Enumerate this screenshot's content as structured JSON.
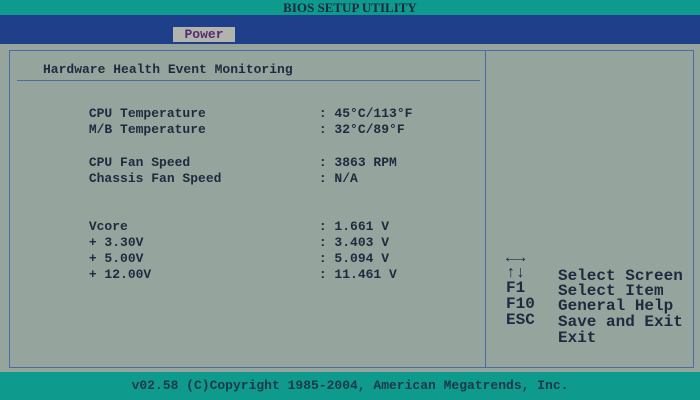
{
  "title": "BIOS SETUP UTILITY",
  "menu": {
    "active_tab": "Power"
  },
  "section": {
    "title": "Hardware Health Event Monitoring"
  },
  "readings": [
    {
      "label": "CPU Temperature",
      "value": ": 45°C/113°F"
    },
    {
      "label": "M/B Temperature",
      "value": ": 32°C/89°F"
    },
    {
      "label": "CPU Fan Speed",
      "value": ": 3863 RPM"
    },
    {
      "label": "Chassis Fan Speed",
      "value": ": N/A"
    },
    {
      "label": "Vcore",
      "value": ": 1.661 V"
    },
    {
      "label": "+ 3.30V",
      "value": ": 3.403 V"
    },
    {
      "label": "+ 5.00V",
      "value": ": 5.094 V"
    },
    {
      "label": "+ 12.00V",
      "value": ": 11.461 V"
    }
  ],
  "help": [
    {
      "key": "←→",
      "desc": "Select Screen"
    },
    {
      "key": "↑↓",
      "desc": "Select Item"
    },
    {
      "key": "F1",
      "desc": "General Help"
    },
    {
      "key": "F10",
      "desc": "Save and Exit"
    },
    {
      "key": "ESC",
      "desc": "Exit"
    }
  ],
  "footer": "v02.58 (C)Copyright 1985-2004, American Megatrends, Inc.",
  "colors": {
    "background": "#95a59d",
    "title_bar": "#0f9a8e",
    "menu_bar": "#1f3f8a",
    "active_tab": "#b0b4ac",
    "border": "#4a6aa8",
    "text": "#1e2a3e"
  }
}
